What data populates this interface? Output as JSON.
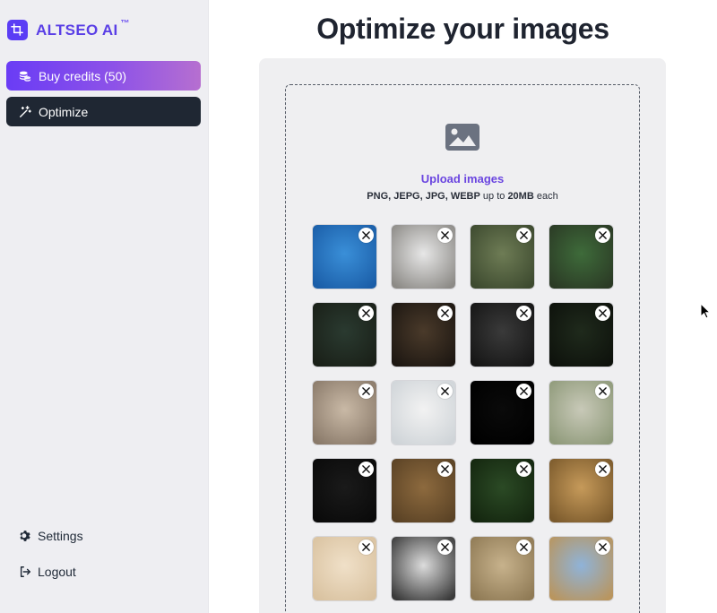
{
  "brand": {
    "name": "ALTSEO AI",
    "tm": "™"
  },
  "nav": {
    "buy_credits": "Buy credits (50)",
    "optimize": "Optimize"
  },
  "footer_links": {
    "settings": "Settings",
    "logout": "Logout"
  },
  "page": {
    "title": "Optimize your images"
  },
  "upload": {
    "title": "Upload images",
    "formats": "PNG, JEPG, JPG, WEBP",
    "up_to": "up to",
    "size": "20MB",
    "each": "each"
  },
  "colors": {
    "accent": "#5a3fe6",
    "credits_gradient": [
      "#6a3cf5",
      "#b66fd0"
    ],
    "optimize_bg": "#1f2733",
    "sidebar_bg": "#eeeef2"
  },
  "images": [
    {
      "subject": "dolphin",
      "bg": [
        "#3a8fd8",
        "#1b5ea8"
      ]
    },
    {
      "subject": "owl",
      "bg": [
        "#e7e7e7",
        "#8c8a86"
      ]
    },
    {
      "subject": "deer-in-forest",
      "bg": [
        "#6e7c55",
        "#3d4a2f"
      ]
    },
    {
      "subject": "dog-on-grass",
      "bg": [
        "#3e6b3a",
        "#2b3a25"
      ]
    },
    {
      "subject": "orange-frog",
      "bg": [
        "#2a3a30",
        "#1a2018"
      ]
    },
    {
      "subject": "eagle-owl",
      "bg": [
        "#4a3a2a",
        "#1d1712"
      ]
    },
    {
      "subject": "fox-and-cat",
      "bg": [
        "#3a3a3a",
        "#161616"
      ]
    },
    {
      "subject": "lorikeets",
      "bg": [
        "#1f2a1c",
        "#0e120c"
      ]
    },
    {
      "subject": "sphynx-cat",
      "bg": [
        "#c9b9a6",
        "#8a7a6a"
      ]
    },
    {
      "subject": "bald-eagle",
      "bg": [
        "#f2f2f2",
        "#cfd4d8"
      ]
    },
    {
      "subject": "betta-fish",
      "bg": [
        "#0a0a0a",
        "#000000"
      ]
    },
    {
      "subject": "chameleon",
      "bg": [
        "#c8c9b8",
        "#8f9a7a"
      ]
    },
    {
      "subject": "flamingos",
      "bg": [
        "#1a1a1a",
        "#0a0a0a"
      ]
    },
    {
      "subject": "dogs-running",
      "bg": [
        "#8d6a3e",
        "#5a4225"
      ]
    },
    {
      "subject": "beetle-on-leaf",
      "bg": [
        "#2b4a25",
        "#14260f"
      ]
    },
    {
      "subject": "leopard",
      "bg": [
        "#c69a5a",
        "#7b5a2c"
      ]
    },
    {
      "subject": "antelope",
      "bg": [
        "#f0e0c8",
        "#d9c2a0"
      ]
    },
    {
      "subject": "zebras",
      "bg": [
        "#dcdcdc",
        "#3a3a3a"
      ]
    },
    {
      "subject": "lion-cubs",
      "bg": [
        "#c7b28c",
        "#8f7a55"
      ]
    },
    {
      "subject": "cowboy-on-horse",
      "bg": [
        "#8fb3d9",
        "#b9955e"
      ]
    }
  ]
}
